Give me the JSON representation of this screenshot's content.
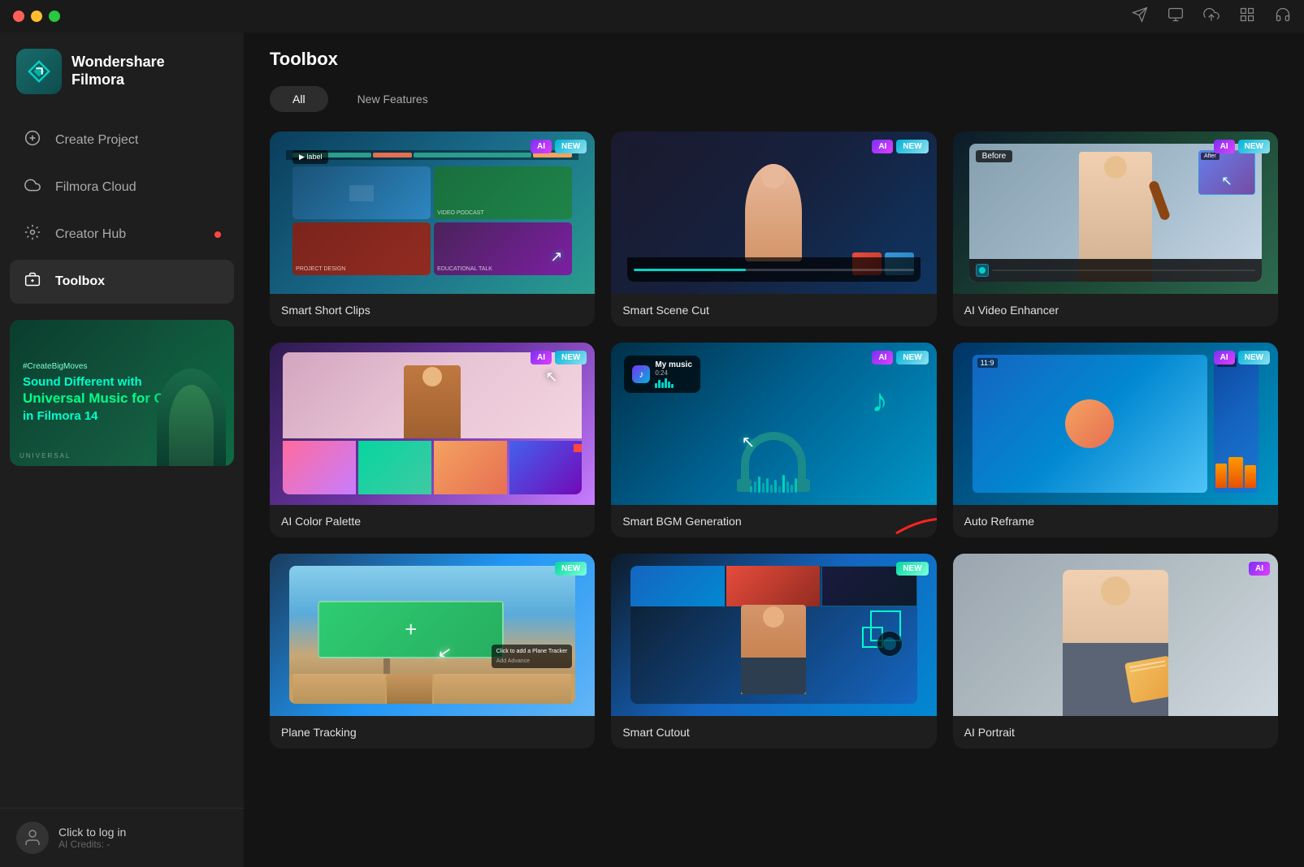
{
  "app": {
    "title": "Wondershare Filmora",
    "line1": "Wondershare",
    "line2": "Filmora"
  },
  "titlebar": {
    "icons": [
      "send",
      "monitor",
      "cloud-upload",
      "grid",
      "headphones"
    ]
  },
  "sidebar": {
    "nav_items": [
      {
        "id": "create-project",
        "label": "Create Project",
        "icon": "+"
      },
      {
        "id": "filmora-cloud",
        "label": "Filmora Cloud",
        "icon": "☁"
      },
      {
        "id": "creator-hub",
        "label": "Creator Hub",
        "icon": "💡",
        "has_dot": true
      },
      {
        "id": "toolbox",
        "label": "Toolbox",
        "icon": "🧰",
        "active": true
      }
    ],
    "banner": {
      "small_text": "#CreateBigMoves",
      "title_line1": "Sound Different with",
      "title_bold": "Universal Music for Creators",
      "title_line2": "in Filmora 14",
      "logo_text": "UNIVERSAL"
    },
    "user": {
      "login_label": "Click to log in",
      "credits_label": "AI Credits: -"
    }
  },
  "main": {
    "title": "Toolbox",
    "tabs": [
      {
        "id": "all",
        "label": "All",
        "active": true
      },
      {
        "id": "new-features",
        "label": "New Features",
        "active": false
      }
    ],
    "tools": [
      {
        "id": "smart-short-clips",
        "title": "Smart Short Clips",
        "badges": [
          "AI",
          "NEW"
        ],
        "badge_types": [
          "ai",
          "new"
        ]
      },
      {
        "id": "smart-scene-cut",
        "title": "Smart Scene Cut",
        "badges": [
          "AI",
          "NEW"
        ],
        "badge_types": [
          "ai",
          "new"
        ]
      },
      {
        "id": "ai-video-enhancer",
        "title": "AI Video Enhancer",
        "badges": [
          "AI",
          "NEW"
        ],
        "badge_types": [
          "ai",
          "new"
        ]
      },
      {
        "id": "ai-color-palette",
        "title": "AI Color Palette",
        "badges": [
          "AI",
          "NEW"
        ],
        "badge_types": [
          "ai",
          "new"
        ]
      },
      {
        "id": "smart-bgm-generation",
        "title": "Smart BGM Generation",
        "badges": [
          "AI",
          "NEW"
        ],
        "badge_types": [
          "ai",
          "new"
        ]
      },
      {
        "id": "auto-reframe",
        "title": "Auto Reframe",
        "badges": [
          "AI",
          "NEW"
        ],
        "badge_types": [
          "ai",
          "new"
        ]
      },
      {
        "id": "plane-tracking",
        "title": "Plane Tracking",
        "badges": [
          "NEW"
        ],
        "badge_types": [
          "new"
        ]
      },
      {
        "id": "smart-cutout",
        "title": "Smart Cutout",
        "badges": [
          "NEW"
        ],
        "badge_types": [
          "new"
        ]
      },
      {
        "id": "ai-portrait",
        "title": "AI Portrait",
        "badges": [
          "AI"
        ],
        "badge_types": [
          "ai"
        ]
      }
    ]
  }
}
